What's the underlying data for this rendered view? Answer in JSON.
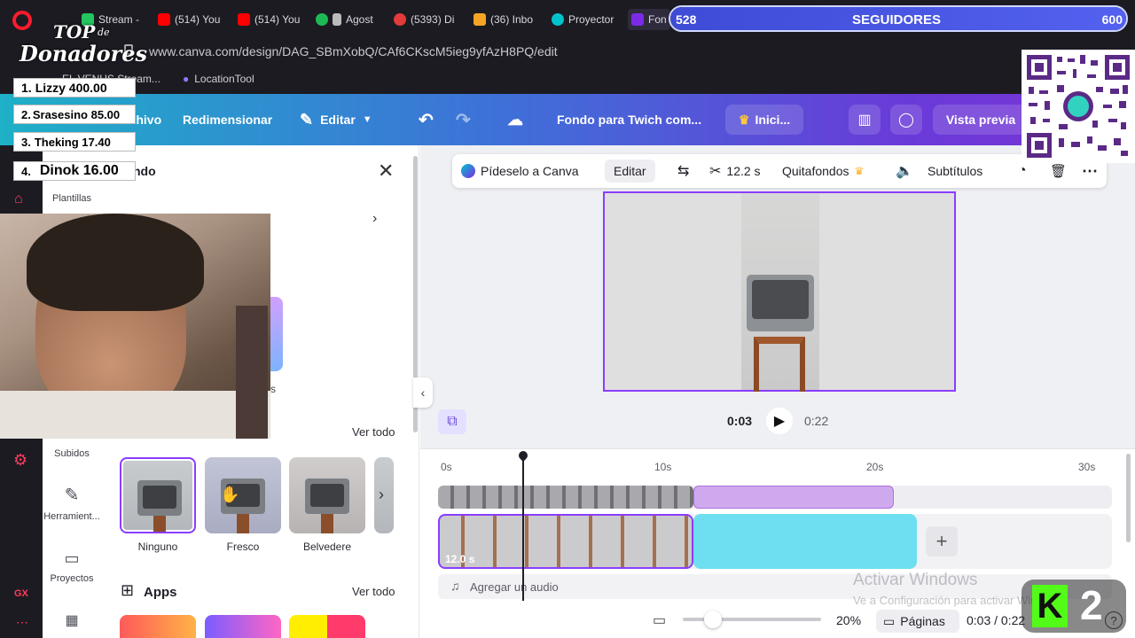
{
  "browser": {
    "tabs": [
      {
        "label": "Stream -",
        "color": "#22c55e"
      },
      {
        "label": "(514) You",
        "color": "#ff0000"
      },
      {
        "label": "(514) You",
        "color": "#ff0000"
      },
      {
        "label": "Agost",
        "color": "#1db954"
      },
      {
        "label": "(5393) Di",
        "color": "#e23b3b"
      },
      {
        "label": "(36) Inbo",
        "color": "#f5a524"
      },
      {
        "label": "Proyector",
        "color": "#00c4cc"
      },
      {
        "label": "Fon",
        "color": "#7d2ae8"
      }
    ],
    "url": "www.canva.com/design/DAG_SBmXobQ/CAf6CKscM5ieg9yfAzH8PQ/edit",
    "bookmarks": [
      "EL VENUS Stream...",
      "LocationTool"
    ]
  },
  "followers": {
    "count": "528",
    "label": "SEGUIDORES",
    "goal": "600"
  },
  "donors": {
    "title_top": "TOP",
    "title_mid": "de",
    "title_bottom": "Donadores",
    "list": [
      {
        "rank": "1.",
        "text": "Lizzy 400.00"
      },
      {
        "rank": "2.",
        "text": "Srasesino 85.00"
      },
      {
        "rank": "3.",
        "text": "Theking 17.40"
      },
      {
        "rank": "4.",
        "text": "Dinok 16.00"
      }
    ]
  },
  "header": {
    "file": "Archivo",
    "resize": "Redimensionar",
    "edit": "Editar",
    "title": "Fondo para Twich com...",
    "start": "Inici...",
    "preview": "Vista previa"
  },
  "rail": {
    "templates": "Plantillas",
    "uploads": "Subidos",
    "tools": "Herramient...",
    "projects": "Proyectos"
  },
  "panel": {
    "title_fragment": "ndo",
    "see_all_1": "Ver todo",
    "see_all_2": "Ver todo",
    "filters": [
      "Ninguno",
      "Fresco",
      "Belvedere"
    ],
    "apps": "Apps",
    "partial_label": "s"
  },
  "toolbar": {
    "ask": "Pídeselo a Canva",
    "edit": "Editar",
    "duration": "12.2 s",
    "bg_remover": "Quitafondos",
    "subtitles": "Subtítulos"
  },
  "playback": {
    "current": "0:03",
    "total": "0:22"
  },
  "timeline": {
    "marks": [
      "0s",
      "10s",
      "20s",
      "30s"
    ],
    "clip_duration": "12.0 s",
    "add_audio": "Agregar un audio"
  },
  "bottom": {
    "zoom": "20%",
    "pages": "Páginas",
    "time": "0:03 / 0:22"
  },
  "watermark": {
    "line1": "Activar Windows",
    "line2": "Ve a Configuración para activar Windows."
  },
  "kick": {
    "letter": "K",
    "number": "2"
  },
  "colors": {
    "accent": "#8b3dff",
    "teal": "#6ddff0",
    "pink": "#e04ad8"
  }
}
